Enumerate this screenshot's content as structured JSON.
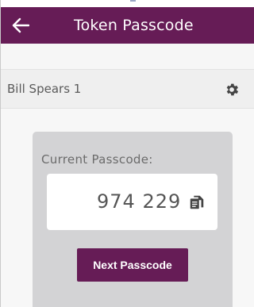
{
  "header": {
    "title": "Token Passcode",
    "back_icon": "arrow-left-icon"
  },
  "account": {
    "name": "Bill Spears 1",
    "settings_icon": "gear-icon"
  },
  "passcode": {
    "label": "Current Passcode:",
    "value": "974 229",
    "copy_icon": "copy-icon"
  },
  "actions": {
    "next_label": "Next Passcode"
  },
  "colors": {
    "brand": "#661c56",
    "card": "#d3d3d5",
    "icon": "#444444"
  }
}
